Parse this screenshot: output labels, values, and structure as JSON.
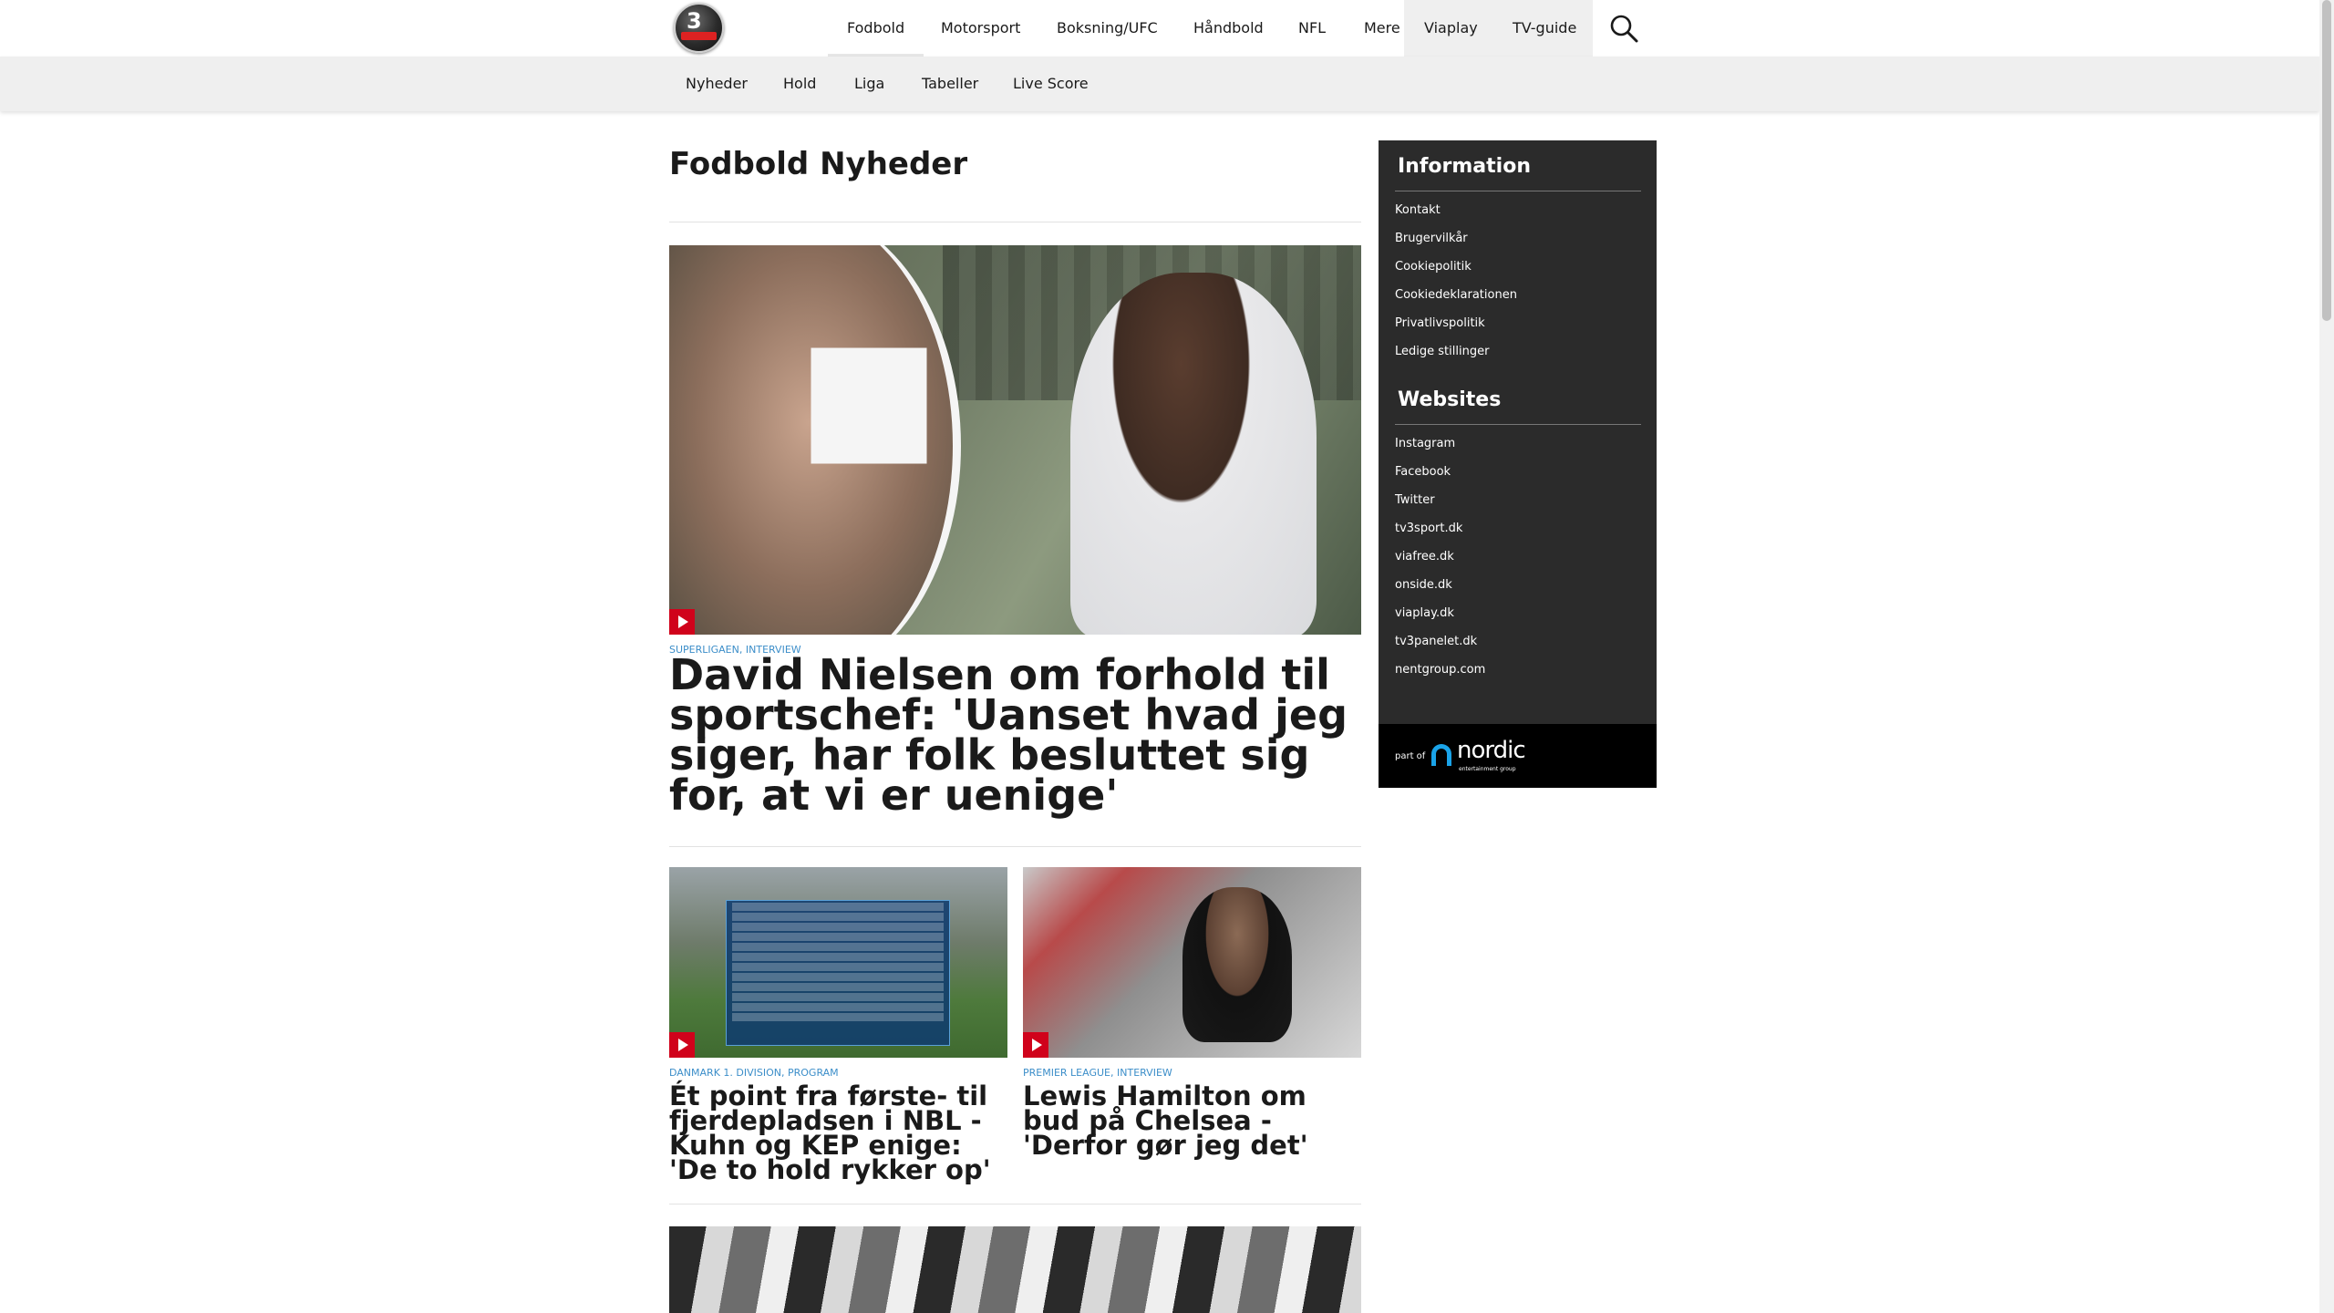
{
  "nav": {
    "items": [
      "Fodbold",
      "Motorsport",
      "Boksning/UFC",
      "Håndbold",
      "NFL",
      "Mere",
      "Viaplay",
      "TV-guide"
    ],
    "active": "Fodbold"
  },
  "icons": {
    "logo": "tv3-sport-logo",
    "search": "search-icon",
    "play": "play-icon",
    "brand": "nordic-entertainment-logo"
  },
  "subnav": {
    "items": [
      "Nyheder",
      "Hold",
      "Liga",
      "Tabeller",
      "Live Score"
    ]
  },
  "page": {
    "title_light": "Fodbold",
    "title_bold": "Nyheder"
  },
  "hero": {
    "tags": [
      "SUPERLIGAEN",
      "INTERVIEW"
    ],
    "headline": "David Nielsen om forhold til sportschef: 'Uanset hvad jeg siger, har folk besluttet sig for, at vi er uenige'"
  },
  "cards": [
    {
      "tags": [
        "DANMARK 1. DIVISION",
        "PROGRAM"
      ],
      "headline": "Ét point fra første- til fjerdepladsen i NBL - Kuhn og KEP enige: 'De to hold rykker op'"
    },
    {
      "tags": [
        "PREMIER LEAGUE",
        "INTERVIEW"
      ],
      "headline": "Lewis Hamilton om bud på Chelsea - 'Derfor gør jeg det'"
    }
  ],
  "sidebar": {
    "info_title": "Information",
    "info_links": [
      "Kontakt",
      "Brugervilkår",
      "Cookiepolitik",
      "Cookiedeklarationen",
      "Privatlivspolitik",
      "Ledige stillinger"
    ],
    "web_title": "Websites",
    "web_links": [
      "Instagram",
      "Facebook",
      "Twitter",
      "tv3sport.dk",
      "viafree.dk",
      "onside.dk",
      "viaplay.dk",
      "tv3panelet.dk",
      "nentgroup.com"
    ],
    "footer": {
      "part_of": "part of",
      "brand": "nordic",
      "brand_sub": "entertainment group"
    }
  },
  "colors": {
    "accent_tag": "#3c8ec9",
    "play_badge": "#d0021b",
    "sidebar_bg": "#2b2b2b",
    "subnav_bg": "#efefef"
  }
}
